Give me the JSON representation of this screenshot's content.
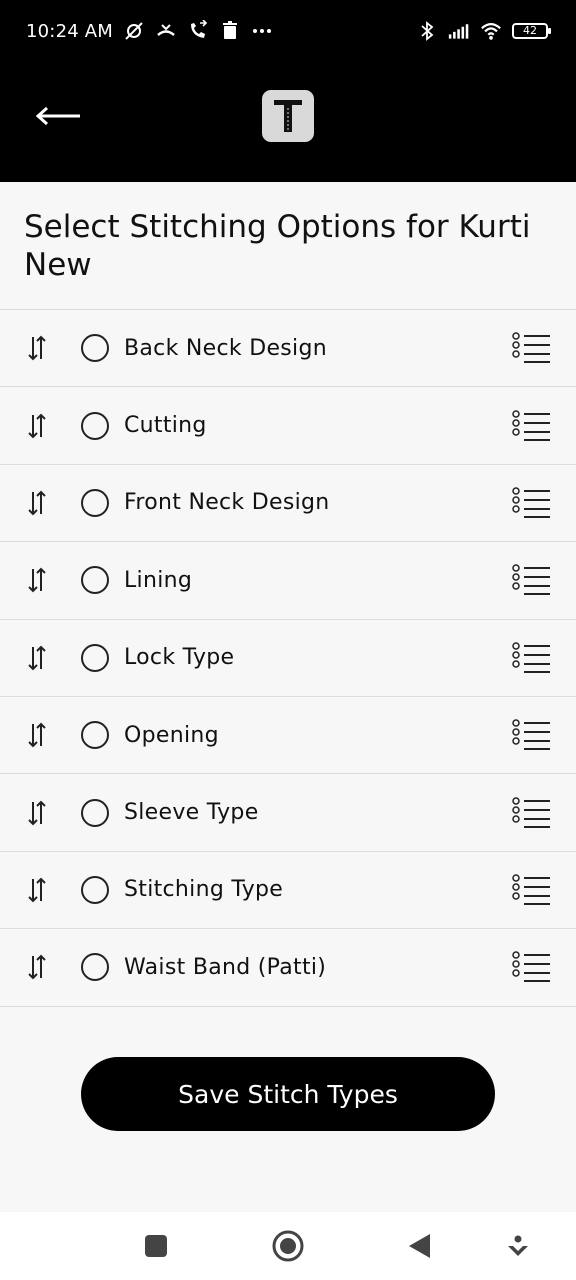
{
  "status_bar": {
    "time": "10:24 AM",
    "battery": "42",
    "left_icons": [
      "muted-alarm-icon",
      "missed-call-icon",
      "call-forward-icon",
      "trash-icon",
      "more-dots-icon"
    ],
    "right_icons": [
      "bluetooth-icon",
      "signal-icon",
      "wifi-icon",
      "battery-icon"
    ]
  },
  "app_bar": {
    "back_icon": "arrow-left-icon",
    "logo_icon": "tailor-logo-icon"
  },
  "page": {
    "title": "Select Stitching Options for Kurti New"
  },
  "options": [
    {
      "label": "Back Neck Design",
      "selected": false
    },
    {
      "label": "Cutting",
      "selected": false
    },
    {
      "label": "Front Neck Design",
      "selected": false
    },
    {
      "label": "Lining",
      "selected": false
    },
    {
      "label": "Lock Type",
      "selected": false
    },
    {
      "label": "Opening",
      "selected": false
    },
    {
      "label": "Sleeve Type",
      "selected": false
    },
    {
      "label": "Stitching Type",
      "selected": false
    },
    {
      "label": "Waist Band (Patti)",
      "selected": false
    }
  ],
  "save_button": {
    "label": "Save Stitch Types"
  },
  "nav_bar": {
    "icons": [
      "recents-square-icon",
      "home-circle-icon",
      "back-triangle-icon",
      "assistant-icon"
    ]
  },
  "colors": {
    "header_bg": "#000000",
    "page_bg": "#f7f7f7",
    "button_bg": "#000000",
    "button_text": "#ffffff"
  }
}
